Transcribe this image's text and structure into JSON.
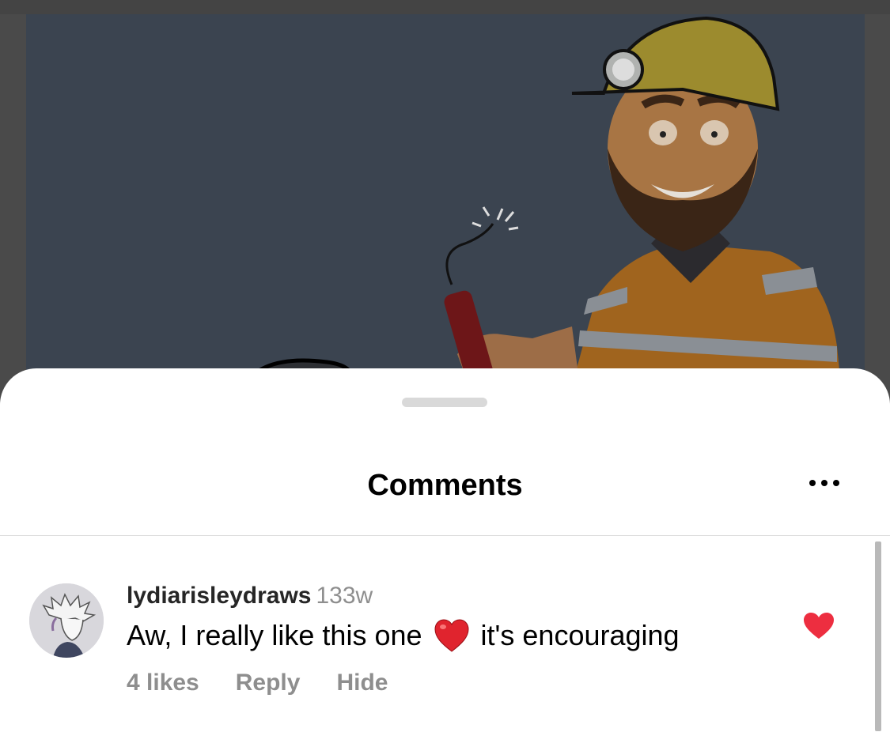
{
  "sheet": {
    "title": "Comments",
    "more_icon": "more-horizontal-icon"
  },
  "comment": {
    "username": "lydiarisleydraws",
    "time": "133w",
    "text_before": "Aw, I really like this one",
    "emoji": "heart-emoji",
    "text_after": "it's encouraging",
    "likes": "4 likes",
    "reply_label": "Reply",
    "hide_label": "Hide",
    "liked": true,
    "like_icon": "heart-filled-icon"
  },
  "colors": {
    "like_red": "#ed2e40",
    "secondary_text": "#8e8e8e"
  }
}
